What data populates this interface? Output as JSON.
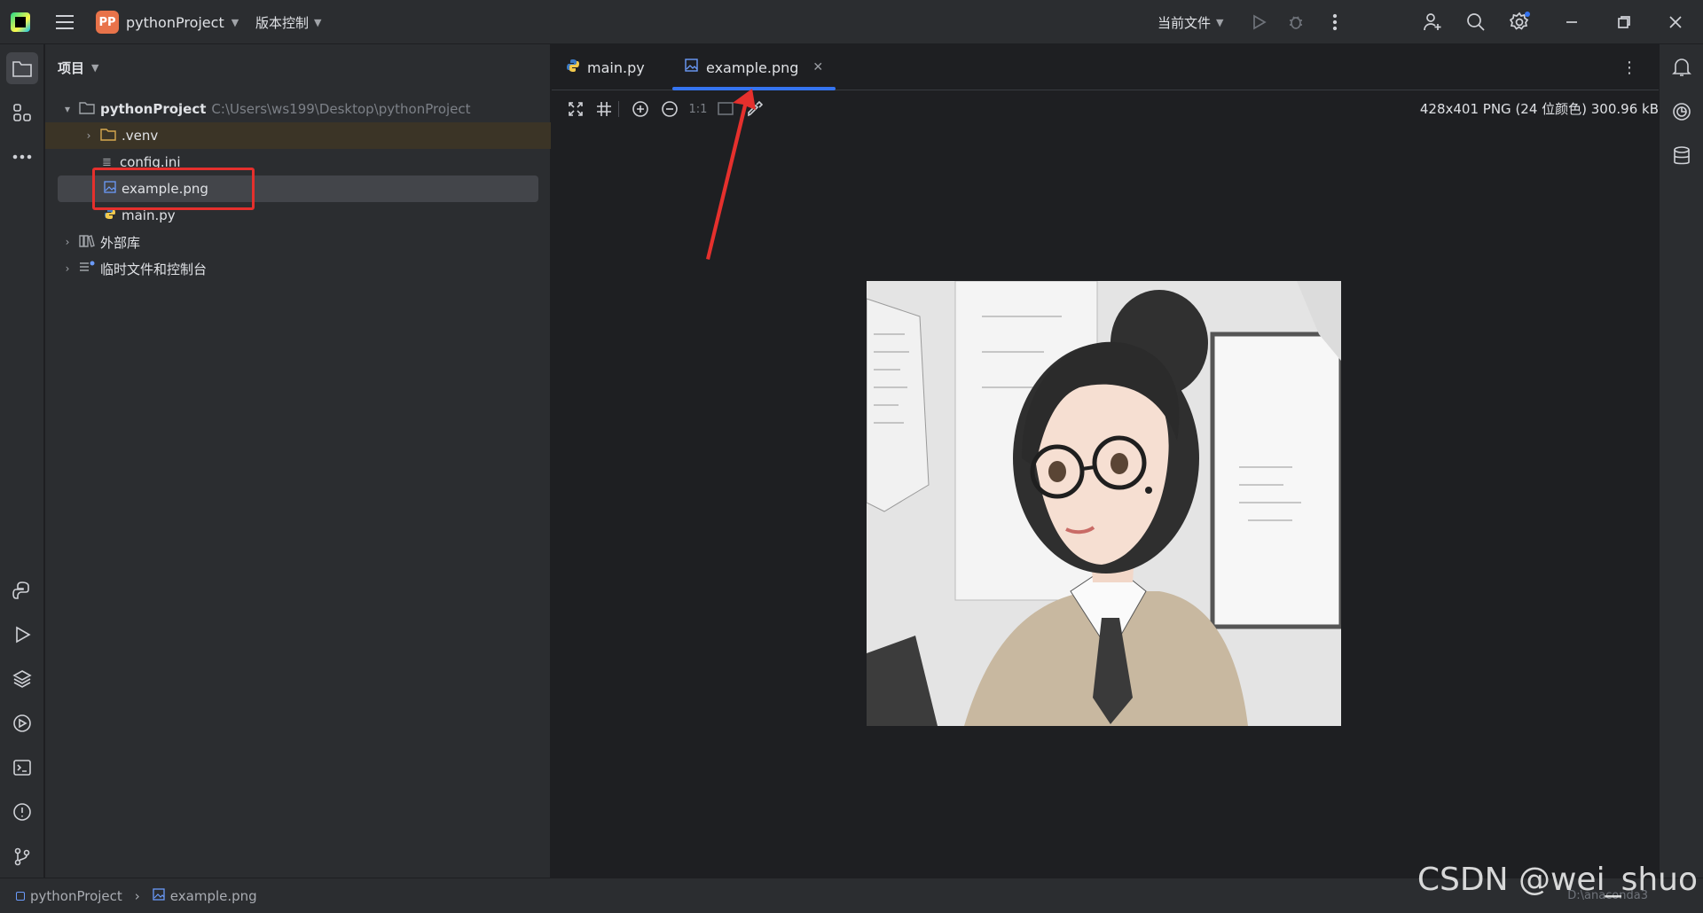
{
  "titlebar": {
    "project_badge": "PP",
    "project_name": "pythonProject",
    "vcs_label": "版本控制",
    "run_config": "当前文件"
  },
  "panel": {
    "title": "项目",
    "root_name": "pythonProject",
    "root_path": "C:\\Users\\ws199\\Desktop\\pythonProject",
    "items": [
      {
        "label": ".venv"
      },
      {
        "label": "config.ini"
      },
      {
        "label": "example.png"
      },
      {
        "label": "main.py"
      },
      {
        "label": "外部库"
      },
      {
        "label": "临时文件和控制台"
      }
    ]
  },
  "editor": {
    "tabs": [
      {
        "label": "main.py"
      },
      {
        "label": "example.png"
      }
    ],
    "zoom_actual": "1:1",
    "image_info": "428x401 PNG (24 位颜色) 300.96 kB"
  },
  "statusbar": {
    "project": "pythonProject",
    "file": "example.png",
    "interpreter": "D:\\anaconda3"
  },
  "watermark": "CSDN @wei_shuo",
  "colors": {
    "accent": "#3574f0",
    "annotation": "#e5302d",
    "badge": "#e8734a"
  }
}
